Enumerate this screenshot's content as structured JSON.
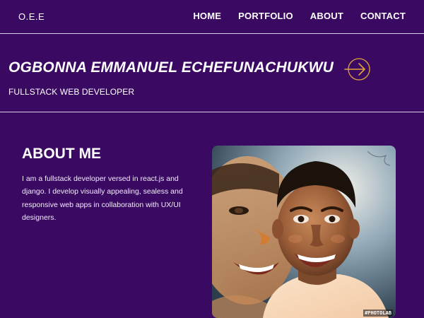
{
  "navbar": {
    "logo": "O.E.E",
    "links": [
      {
        "label": "HOME"
      },
      {
        "label": "PORTFOLIO"
      },
      {
        "label": "ABOUT"
      },
      {
        "label": "CONTACT"
      }
    ]
  },
  "hero": {
    "name": "OGBONNA EMMANUEL ECHEFUNACHUKWU",
    "role": "FULLSTACK WEB DEVELOPER",
    "arrow_icon": "arrow-right-circle-icon",
    "arrow_color": "#e2a33a"
  },
  "about": {
    "title": "ABOUT ME",
    "text": "I am a fullstack developer versed in react.js and django. I develop visually appealing, sealess and responsive web apps in collaboration with UX/UI designers."
  },
  "portrait": {
    "watermark": "#PHOTOLAB"
  },
  "colors": {
    "background": "#3a0a62",
    "text": "#ffffff",
    "divider": "#d9cfe6",
    "accent": "#e2a33a"
  }
}
